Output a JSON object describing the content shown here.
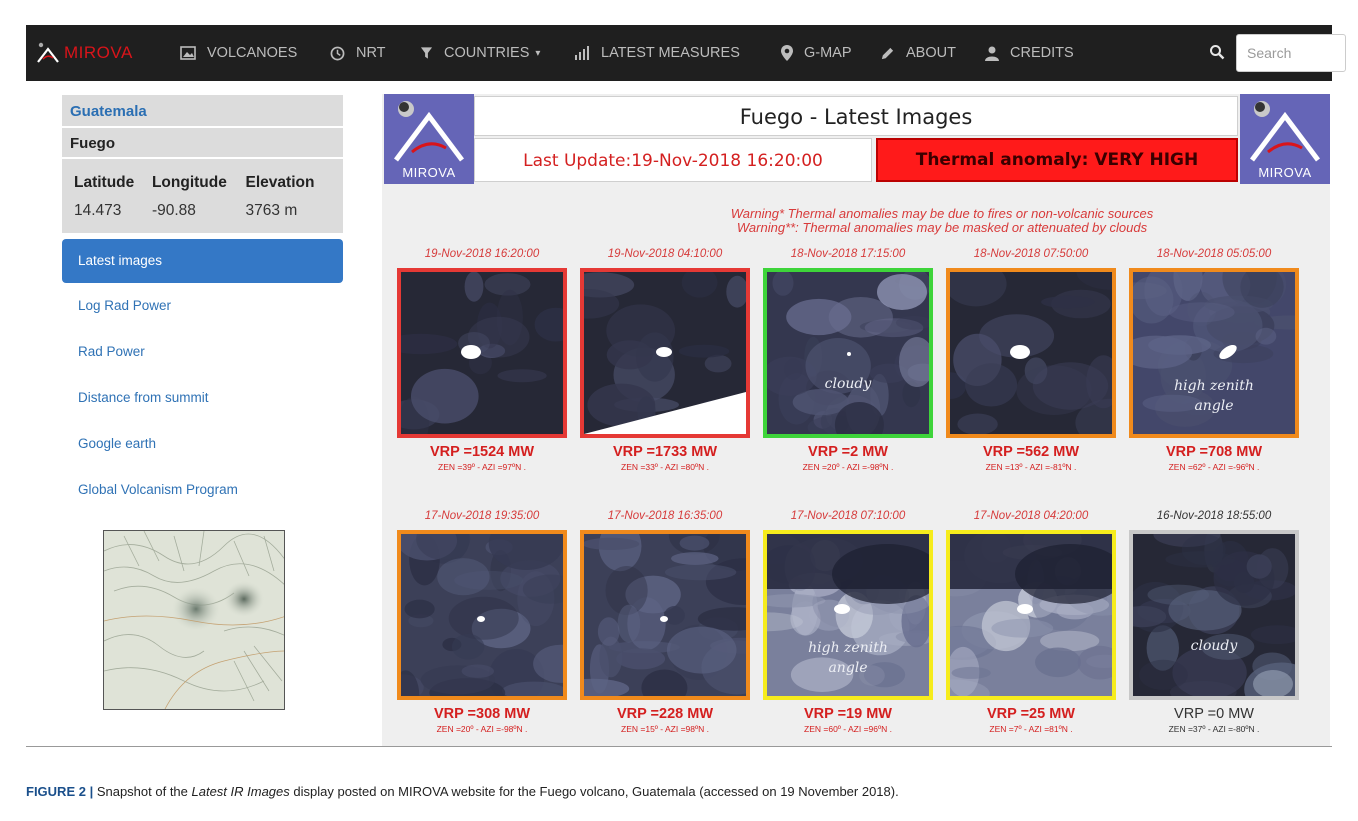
{
  "navbar": {
    "brand": "MIROVA",
    "items": [
      {
        "label": "VOLCANOES",
        "icon": "image-icon",
        "caret": false
      },
      {
        "label": "NRT",
        "icon": "clock-icon",
        "caret": false
      },
      {
        "label": "COUNTRIES",
        "icon": "filter-icon",
        "caret": true
      },
      {
        "label": "LATEST MEASURES",
        "icon": "bar-chart-icon",
        "caret": false
      },
      {
        "label": "G-MAP",
        "icon": "map-marker-icon",
        "caret": false
      },
      {
        "label": "ABOUT",
        "icon": "pencil-icon",
        "caret": false
      },
      {
        "label": "CREDITS",
        "icon": "user-icon",
        "caret": false
      }
    ],
    "search_placeholder": "Search"
  },
  "sidebar": {
    "country": "Guatemala",
    "volcano": "Fuego",
    "headers": [
      "Latitude",
      "Longitude",
      "Elevation"
    ],
    "values": [
      "14.473",
      "-90.88",
      "3763 m"
    ],
    "links": [
      {
        "label": "Latest images",
        "active": true
      },
      {
        "label": "Log Rad Power",
        "active": false
      },
      {
        "label": "Rad Power",
        "active": false
      },
      {
        "label": "Distance from summit",
        "active": false
      },
      {
        "label": "Google earth",
        "active": false
      },
      {
        "label": "Global Volcanism Program",
        "active": false
      }
    ]
  },
  "main": {
    "logo_label": "MIROVA",
    "title": "Fuego - Latest Images",
    "last_update": "Last Update:19-Nov-2018 16:20:00",
    "anomaly": "Thermal anomaly:  VERY HIGH",
    "warning1": "Warning* Thermal anomalies may be due to fires or non-volcanic sources",
    "warning2": "Warning**: Thermal anomalies may be masked or attenuated by clouds",
    "tiles": [
      {
        "date": "19-Nov-2018 16:20:00",
        "frame_color": "#e53935",
        "vrp": "VRP =1524 MW",
        "meta": "ZEN =39º  -  AZI =97ºN .",
        "caption": "",
        "style": "dark"
      },
      {
        "date": "19-Nov-2018 04:10:00",
        "frame_color": "#e53935",
        "vrp": "VRP =1733 MW",
        "meta": "ZEN =33º  -  AZI =80ºN .",
        "caption": "",
        "style": "dark-wedge"
      },
      {
        "date": "18-Nov-2018 17:15:00",
        "frame_color": "#3ed43a",
        "vrp": "VRP =2 MW",
        "meta": "ZEN =20º  -  AZI =-98ºN .",
        "caption": "cloudy",
        "style": "cloudy"
      },
      {
        "date": "18-Nov-2018 07:50:00",
        "frame_color": "#f08a1c",
        "vrp": "VRP =562 MW",
        "meta": "ZEN =13º  -  AZI =-81ºN .",
        "caption": "",
        "style": "dark"
      },
      {
        "date": "18-Nov-2018 05:05:00",
        "frame_color": "#f08a1c",
        "vrp": "VRP =708 MW",
        "meta": "ZEN =62º  -  AZI =-96ºN .",
        "caption": "high zenith angle",
        "style": "zenith"
      },
      {
        "date": "17-Nov-2018 19:35:00",
        "frame_color": "#f08a1c",
        "vrp": "VRP =308 MW",
        "meta": "ZEN =20º  -  AZI =-98ºN .",
        "caption": "",
        "style": "mottled"
      },
      {
        "date": "17-Nov-2018 16:35:00",
        "frame_color": "#f08a1c",
        "vrp": "VRP =228 MW",
        "meta": "ZEN =15º  -  AZI =98ºN .",
        "caption": "",
        "style": "mottled"
      },
      {
        "date": "17-Nov-2018 07:10:00",
        "frame_color": "#f6ec1c",
        "vrp": "VRP =19 MW",
        "meta": "ZEN =60º  -  AZI =96ºN .",
        "caption": "high zenith angle",
        "style": "bright"
      },
      {
        "date": "17-Nov-2018 04:20:00",
        "frame_color": "#f6ec1c",
        "vrp": "VRP =25 MW",
        "meta": "ZEN =7º  -  AZI =81ºN .",
        "caption": "",
        "style": "bright"
      },
      {
        "date": "16-Nov-2018 18:55:00",
        "frame_color": "#c8c8c8",
        "vrp": "VRP =0 MW",
        "meta": "ZEN =37º  -  AZI =-80ºN .",
        "caption": "cloudy",
        "style": "cloudy-grey",
        "grey_text": true
      }
    ]
  },
  "caption": {
    "label": "FIGURE 2 |",
    "text_before": " Snapshot of the ",
    "italic": "Latest IR Images",
    "text_after": " display posted on MIROVA website for the Fuego volcano, Guatemala (accessed on 19 November 2018)."
  }
}
